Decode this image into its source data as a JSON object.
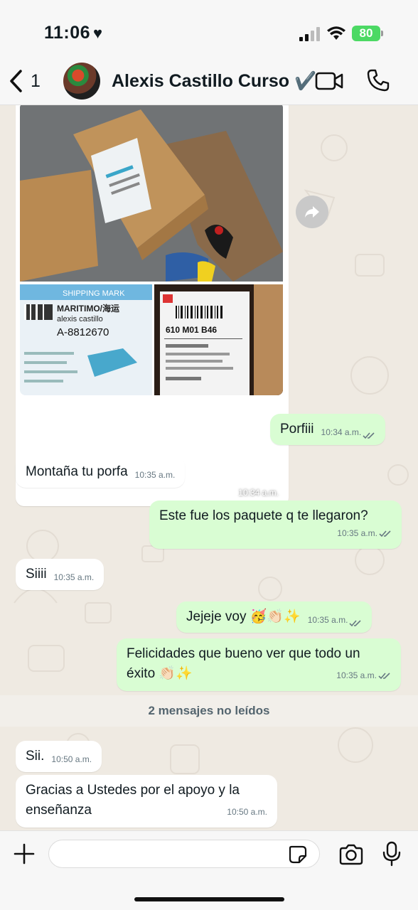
{
  "status_bar": {
    "time": "11:06",
    "heart": "♥",
    "battery": "80"
  },
  "header": {
    "back_count": "1",
    "contact_name": "Alexis Castillo Curso ✔️",
    "icons": [
      "chevron-left-icon",
      "video-call-icon",
      "phone-icon"
    ]
  },
  "image_message": {
    "time": "10:34 a.m.",
    "label_shipping": "SHIPPING MARK",
    "label_maritimo": "MARITIMO/海运",
    "label_name": "alexis castillo",
    "label_code": "A-8812670",
    "label_code2": "610 M01 B46"
  },
  "messages": [
    {
      "dir": "out",
      "text": "Porfiii",
      "time": "10:34 a.m."
    },
    {
      "dir": "in",
      "text": "Montaña tu porfa",
      "time": "10:35 a.m."
    },
    {
      "dir": "out",
      "text": "Este fue los paquete q te llegaron?",
      "time": "10:35 a.m."
    },
    {
      "dir": "in",
      "text": "Siiii",
      "time": "10:35 a.m."
    },
    {
      "dir": "out",
      "text": "Jejeje voy 🥳👏🏻✨",
      "time": "10:35 a.m."
    },
    {
      "dir": "out",
      "text": "Felicidades que bueno ver que todo un éxito 👏🏻✨",
      "time": "10:35 a.m."
    },
    {
      "dir": "in",
      "text": "Sii.",
      "time": "10:50 a.m."
    },
    {
      "dir": "in",
      "text": "Gracias a Ustedes por el apoyo y la enseñanza",
      "time": "10:50 a.m."
    }
  ],
  "unread_divider": "2 mensajes no leídos",
  "input": {
    "placeholder": "",
    "value": ""
  },
  "colors": {
    "outgoing_bubble": "#d9fdd3",
    "incoming_bubble": "#ffffff",
    "chat_background": "#efeae2",
    "battery": "#4cd964"
  }
}
